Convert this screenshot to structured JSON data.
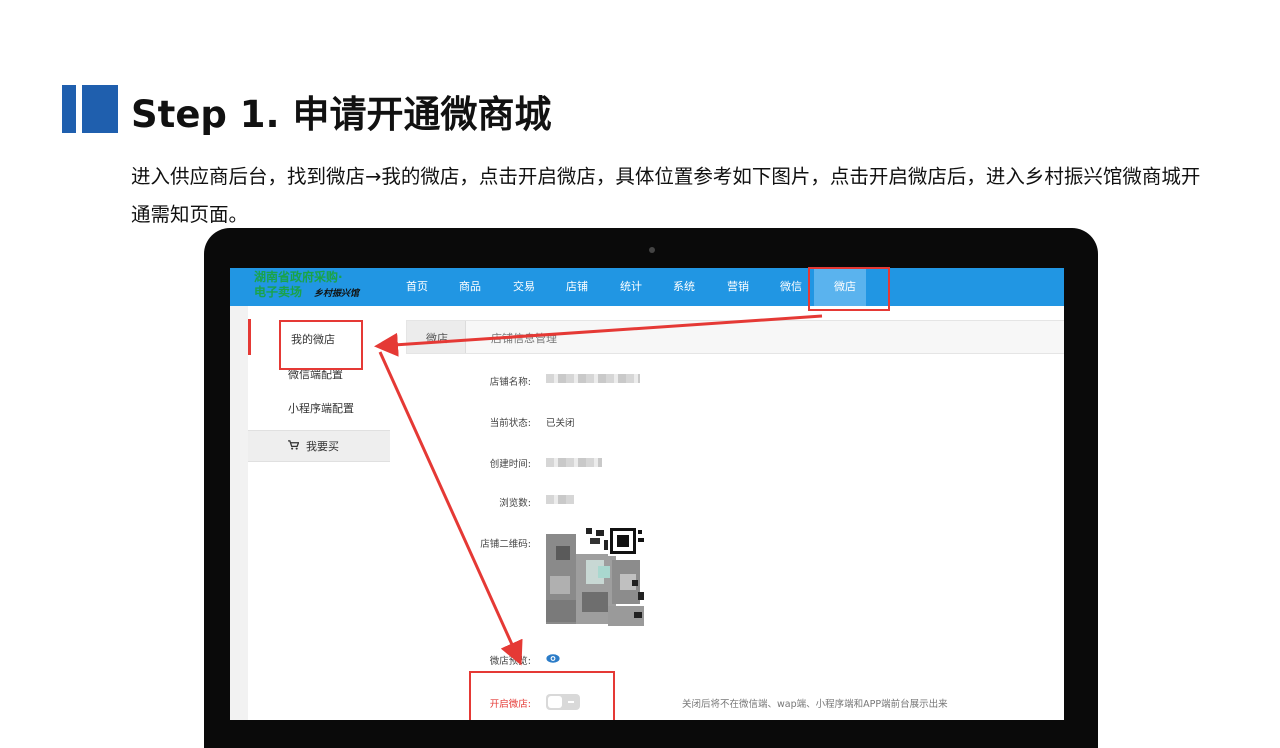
{
  "slide": {
    "title": "Step 1. 申请开通微商城",
    "description": "进入供应商后台，找到微店→我的微店，点击开启微店，具体位置参考如下图片，点击开启微店后，进入乡村振兴馆微商城开通需知页面。"
  },
  "app": {
    "logo_line1": "湖南省政府采购·",
    "logo_line2": "电子卖场",
    "logo_sub": "乡村振兴馆",
    "nav": [
      {
        "label": "首页"
      },
      {
        "label": "商品"
      },
      {
        "label": "交易"
      },
      {
        "label": "店铺"
      },
      {
        "label": "统计"
      },
      {
        "label": "系统"
      },
      {
        "label": "营销"
      },
      {
        "label": "微信"
      },
      {
        "label": "微店",
        "active": true
      }
    ],
    "sidebar": {
      "items": [
        {
          "label": "我的微店",
          "active": true
        },
        {
          "label": "微信端配置"
        },
        {
          "label": "小程序端配置"
        }
      ],
      "buy_label": "我要买"
    },
    "breadcrumb": {
      "tab": "微店",
      "text": "店铺信息管理"
    },
    "fields": {
      "shop_name_label": "店铺名称:",
      "status_label": "当前状态:",
      "status_value": "已关闭",
      "created_label": "创建时间:",
      "views_label": "浏览数:",
      "qr_label": "店铺二维码:",
      "preview_label": "微店预览:",
      "open_label": "开启微店:",
      "open_hint": "关闭后将不在微信端、wap端、小程序端和APP端前台展示出来"
    },
    "colors": {
      "nav_bg": "#2196e3",
      "nav_active": "#5ab3ee",
      "accent_red": "#e53935",
      "title_bar": "#1f5fae",
      "logo_green": "#1aa34a"
    }
  }
}
